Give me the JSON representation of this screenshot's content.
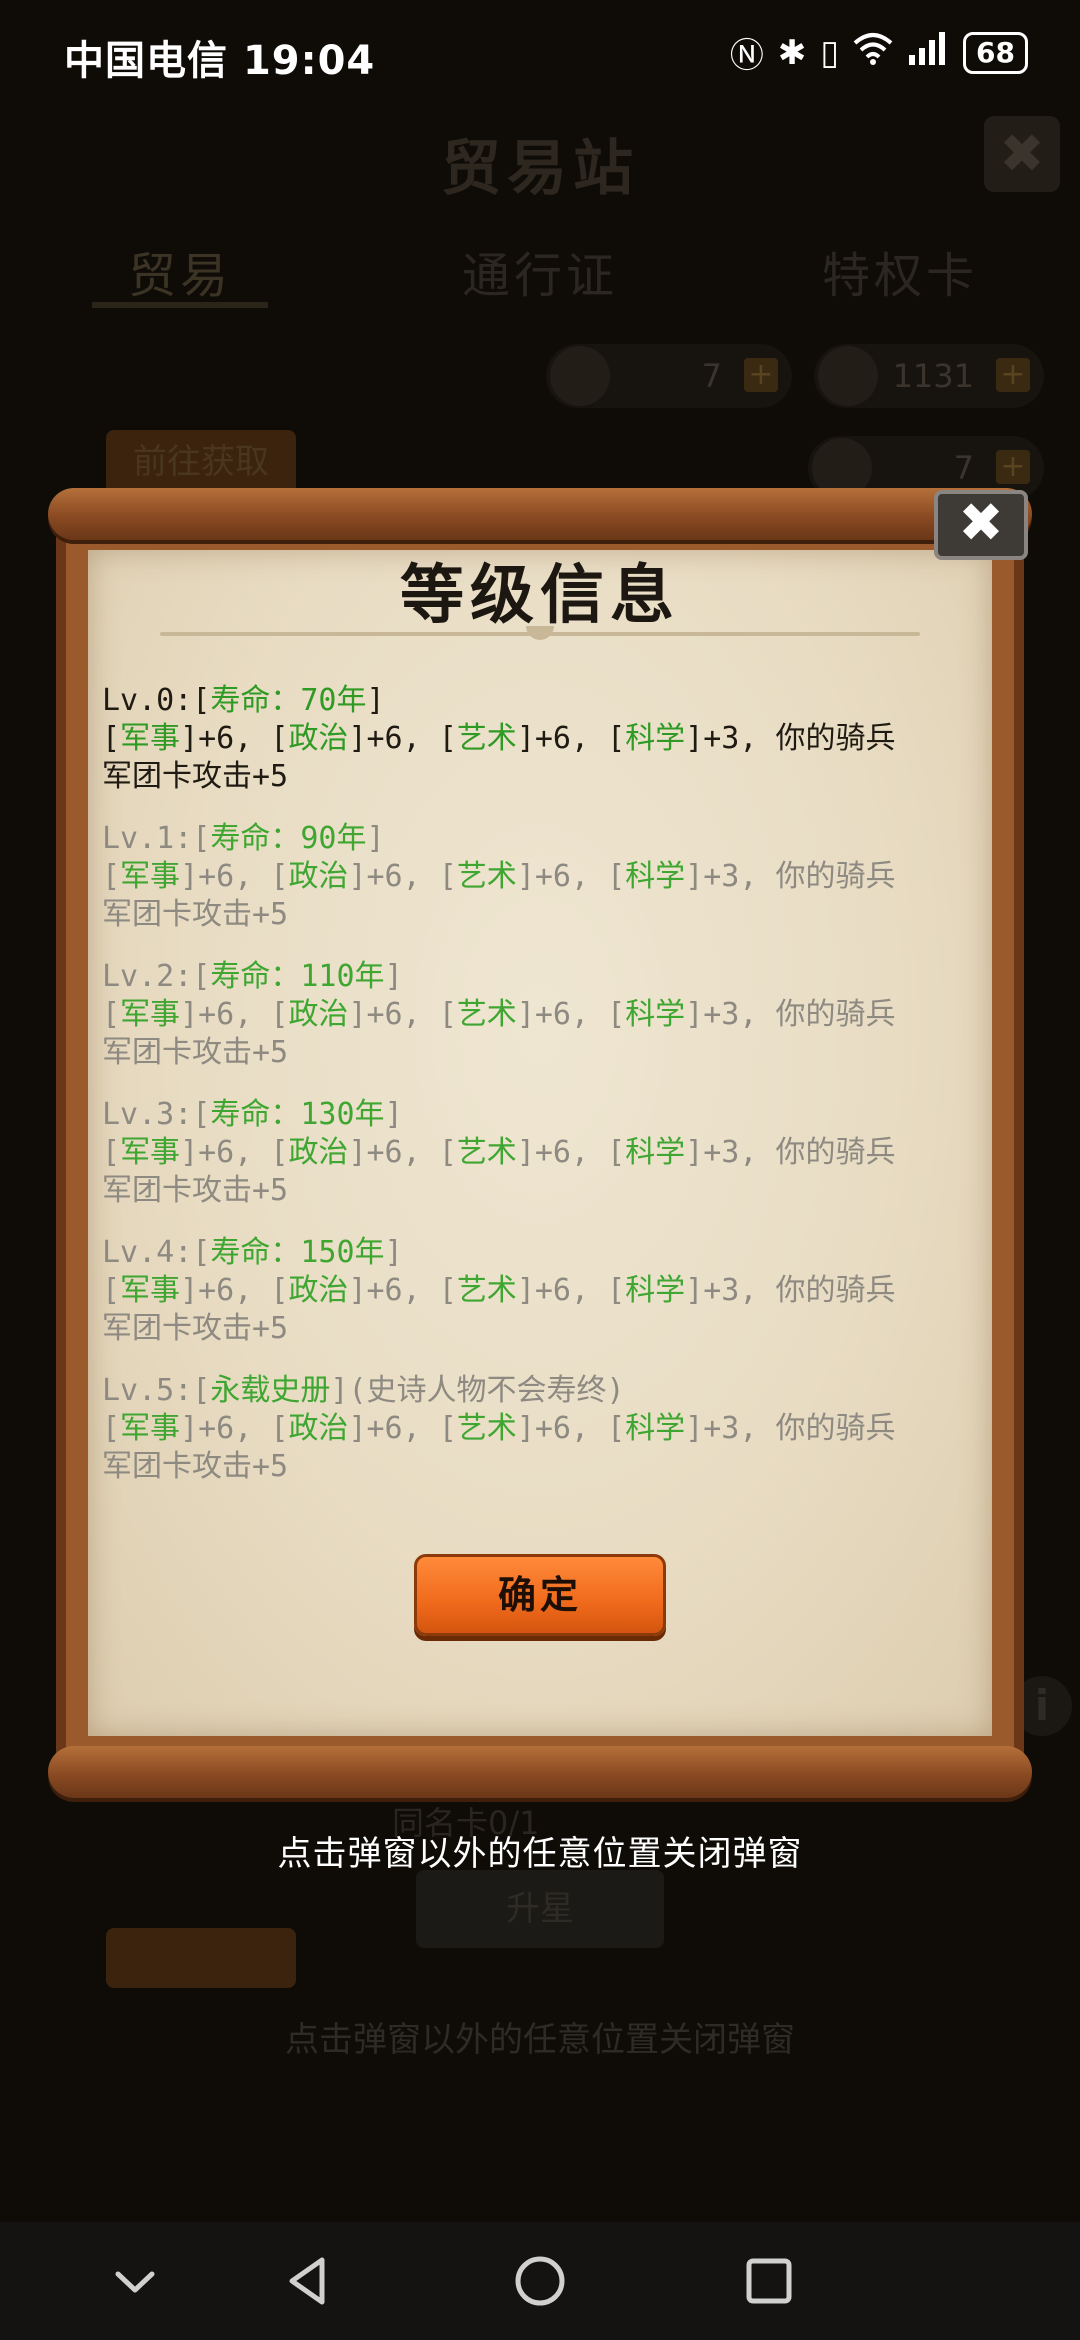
{
  "status_bar": {
    "carrier": "中国电信",
    "time": "19:04",
    "battery": "68"
  },
  "background": {
    "title": "贸易站",
    "tabs": [
      "贸易",
      "通行证",
      "特权卡"
    ],
    "res1_value": "7",
    "res2_value": "1131",
    "res3_value": "7",
    "goto_button": "前往获取",
    "copies_label": "同名卡0/1",
    "upgrade_button": "升星",
    "hint": "点击弹窗以外的任意位置关闭弹窗"
  },
  "popup": {
    "title": "等级信息",
    "levels": [
      {
        "prefix": "Lv.0:[",
        "tag": "寿命：70年",
        "suffix": "]",
        "note": "",
        "bonus_l1": [
          "[",
          "军事",
          "]+6, [",
          "政治",
          "]+6, [",
          "艺术",
          "]+6, [",
          "科学",
          "]+3, 你的骑兵"
        ],
        "bonus_l2": "军团卡攻击+5"
      },
      {
        "prefix": "Lv.1:[",
        "tag": "寿命：90年",
        "suffix": "]",
        "note": "",
        "bonus_l1": [
          "[",
          "军事",
          "]+6, [",
          "政治",
          "]+6, [",
          "艺术",
          "]+6, [",
          "科学",
          "]+3, 你的骑兵"
        ],
        "bonus_l2": "军团卡攻击+5"
      },
      {
        "prefix": "Lv.2:[",
        "tag": "寿命：110年",
        "suffix": "]",
        "note": "",
        "bonus_l1": [
          "[",
          "军事",
          "]+6, [",
          "政治",
          "]+6, [",
          "艺术",
          "]+6, [",
          "科学",
          "]+3, 你的骑兵"
        ],
        "bonus_l2": "军团卡攻击+5"
      },
      {
        "prefix": "Lv.3:[",
        "tag": "寿命：130年",
        "suffix": "]",
        "note": "",
        "bonus_l1": [
          "[",
          "军事",
          "]+6, [",
          "政治",
          "]+6, [",
          "艺术",
          "]+6, [",
          "科学",
          "]+3, 你的骑兵"
        ],
        "bonus_l2": "军团卡攻击+5"
      },
      {
        "prefix": "Lv.4:[",
        "tag": "寿命：150年",
        "suffix": "]",
        "note": "",
        "bonus_l1": [
          "[",
          "军事",
          "]+6, [",
          "政治",
          "]+6, [",
          "艺术",
          "]+6, [",
          "科学",
          "]+3, 你的骑兵"
        ],
        "bonus_l2": "军团卡攻击+5"
      },
      {
        "prefix": "Lv.5:[",
        "tag": "永载史册",
        "suffix": "]",
        "note": "(史诗人物不会寿终)",
        "bonus_l1": [
          "[",
          "军事",
          "]+6, [",
          "政治",
          "]+6, [",
          "艺术",
          "]+6, [",
          "科学",
          "]+3, 你的骑兵"
        ],
        "bonus_l2": "军团卡攻击+5"
      }
    ],
    "confirm_button": "确定",
    "close_icon": "close-icon"
  },
  "hint": "点击弹窗以外的任意位置关闭弹窗",
  "nav": {
    "icons": [
      "chevron-down-icon",
      "back-icon",
      "home-icon",
      "recents-icon"
    ]
  }
}
